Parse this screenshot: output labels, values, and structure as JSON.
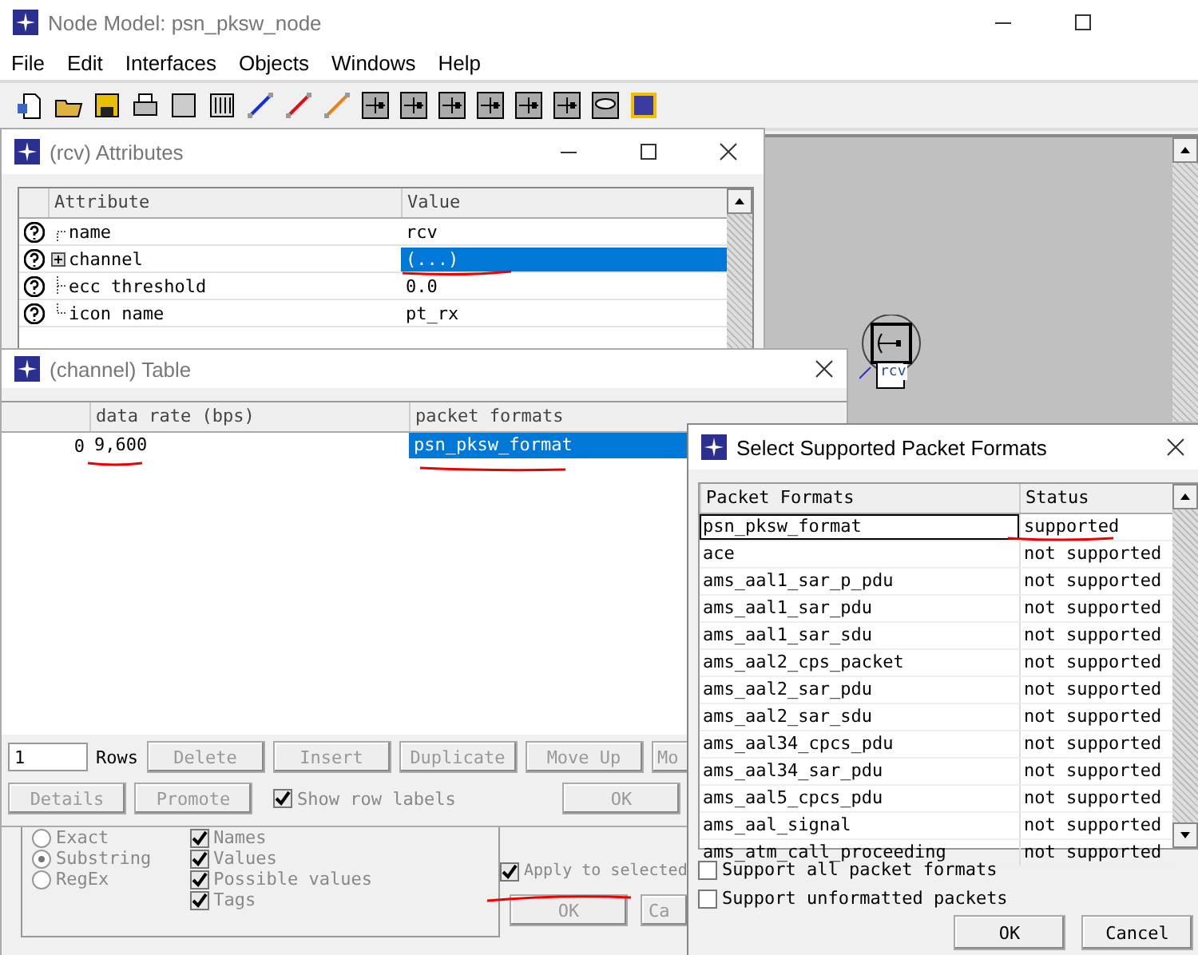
{
  "main_window": {
    "title": "Node Model: psn_pksw_node",
    "menu": [
      "File",
      "Edit",
      "Interfaces",
      "Objects",
      "Windows",
      "Help"
    ],
    "node": {
      "label": "rcv"
    }
  },
  "attributes_window": {
    "title": "(rcv) Attributes",
    "columns": [
      "Attribute",
      "Value"
    ],
    "rows": [
      {
        "kind": "top",
        "name": "name",
        "value": "rcv",
        "selected": false
      },
      {
        "kind": "group",
        "name": "channel",
        "value": "(...)",
        "selected": true
      },
      {
        "kind": "middle",
        "name": "ecc threshold",
        "value": "0.0",
        "selected": false
      },
      {
        "kind": "last",
        "name": "icon name",
        "value": "pt_rx",
        "selected": false
      }
    ],
    "match_options": [
      {
        "label": "Exact",
        "selected": false
      },
      {
        "label": "Substring",
        "selected": true
      },
      {
        "label": "RegEx",
        "selected": false
      }
    ],
    "look_in": [
      {
        "label": "Names",
        "checked": true
      },
      {
        "label": "Values",
        "checked": true
      },
      {
        "label": "Possible values",
        "checked": true
      },
      {
        "label": "Tags",
        "checked": true
      }
    ],
    "apply_to_selected": {
      "label": "Apply to selected",
      "checked": true
    },
    "buttons": [
      "OK",
      "Ca"
    ]
  },
  "table_window": {
    "title": "(channel) Table",
    "columns": [
      "data rate (bps)",
      "packet formats"
    ],
    "rows": [
      {
        "label": "0",
        "cells": [
          {
            "text": "9,600",
            "selected": false
          },
          {
            "text": "psn_pksw_format",
            "selected": true
          }
        ]
      }
    ],
    "row_count": "1",
    "rows_label": "Rows",
    "buttons": [
      {
        "label": "Delete",
        "disabled": true
      },
      {
        "label": "Insert",
        "disabled": true
      },
      {
        "label": "Duplicate",
        "disabled": true
      },
      {
        "label": "Move Up",
        "disabled": true
      },
      {
        "label": "Mo",
        "disabled": true
      }
    ],
    "buttons_2": [
      {
        "label": "Details",
        "disabled": true
      },
      {
        "label": "Promote",
        "disabled": true
      }
    ],
    "show_row_labels": {
      "label": "Show row labels",
      "checked": true
    },
    "ok_button": {
      "label": "OK",
      "disabled": true
    }
  },
  "formats_dialog": {
    "title": "Select Supported Packet Formats",
    "columns": [
      "Packet Formats",
      "Status"
    ],
    "rows": [
      {
        "format": "psn_pksw_format",
        "status": "supported",
        "selected": true
      },
      {
        "format": "ace",
        "status": "not supported",
        "selected": false
      },
      {
        "format": "ams_aal1_sar_p_pdu",
        "status": "not supported",
        "selected": false
      },
      {
        "format": "ams_aal1_sar_pdu",
        "status": "not supported",
        "selected": false
      },
      {
        "format": "ams_aal1_sar_sdu",
        "status": "not supported",
        "selected": false
      },
      {
        "format": "ams_aal2_cps_packet",
        "status": "not supported",
        "selected": false
      },
      {
        "format": "ams_aal2_sar_pdu",
        "status": "not supported",
        "selected": false
      },
      {
        "format": "ams_aal2_sar_sdu",
        "status": "not supported",
        "selected": false
      },
      {
        "format": "ams_aal34_cpcs_pdu",
        "status": "not supported",
        "selected": false
      },
      {
        "format": "ams_aal34_sar_pdu",
        "status": "not supported",
        "selected": false
      },
      {
        "format": "ams_aal5_cpcs_pdu",
        "status": "not supported",
        "selected": false
      },
      {
        "format": "ams_aal_signal",
        "status": "not supported",
        "selected": false
      },
      {
        "format": "ams_atm_call_proceeding",
        "status": "not supported",
        "selected": false
      }
    ],
    "options": [
      {
        "label": "Support all packet formats",
        "checked": false
      },
      {
        "label": "Support unformatted packets",
        "checked": false
      }
    ],
    "buttons": [
      "OK",
      "Cancel"
    ]
  }
}
